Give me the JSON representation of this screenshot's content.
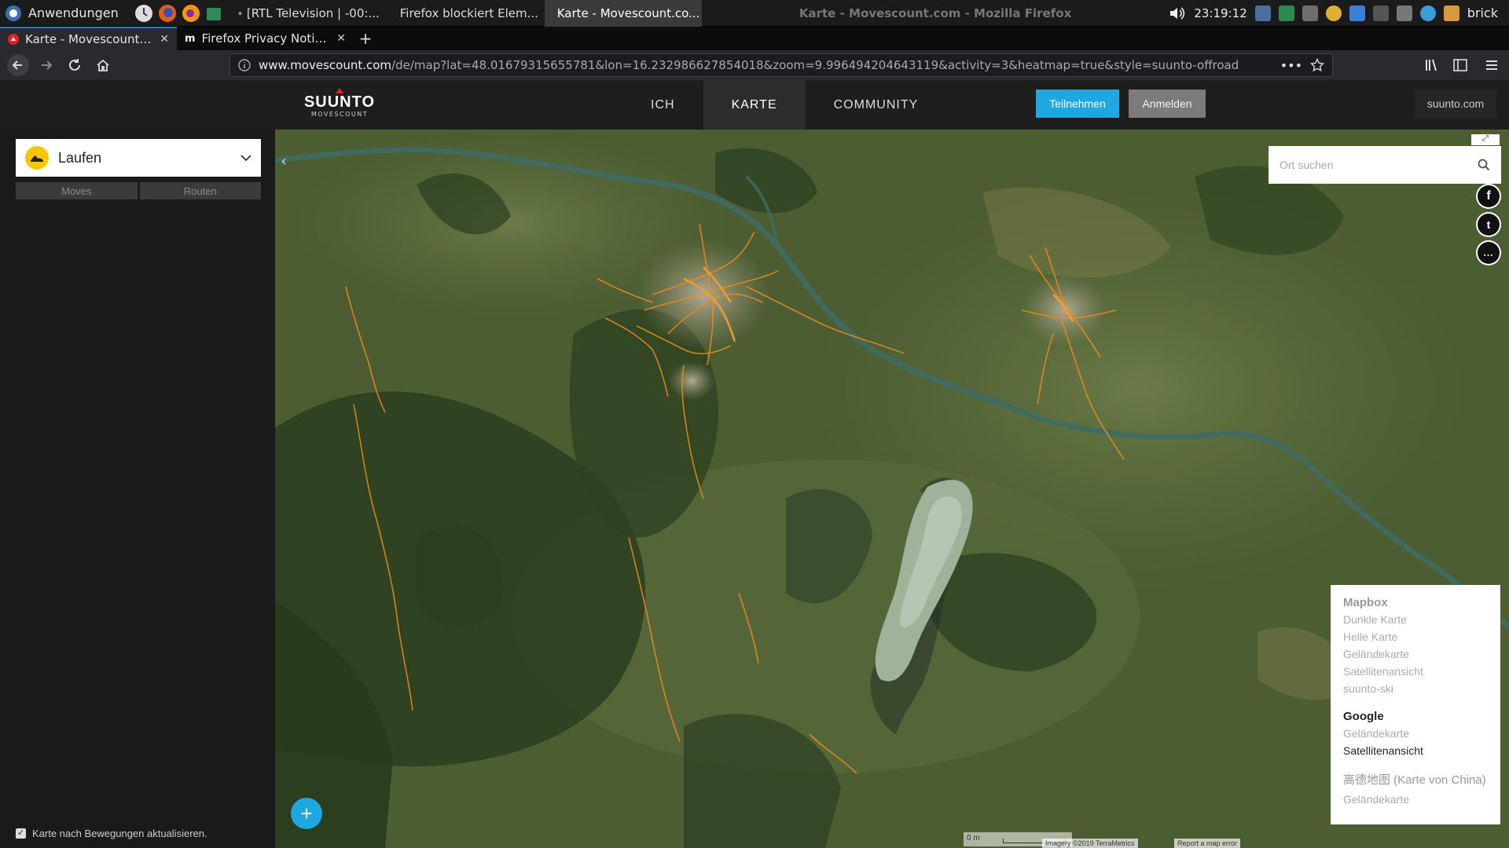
{
  "taskbar": {
    "start_label": "Anwendungen",
    "tasks": [
      {
        "label": "[RTL Television  |  -00:..."
      },
      {
        "label": "Firefox blockiert Elem..."
      },
      {
        "label": "Karte - Movescount.co..."
      }
    ],
    "window_title": "Karte - Movescount.com - Mozilla Firefox",
    "clock": "23:19:12",
    "user": "brick"
  },
  "browser": {
    "tabs": [
      {
        "label": "Karte - Movescount.com"
      },
      {
        "label": "Firefox Privacy Notice —"
      }
    ],
    "url_domain": "www.movescount.com",
    "url_path": "/de/map?lat=48.01679315655781&lon=16.232986627854018&zoom=9.996494204643119&activity=3&heatmap=true&style=suunto-offroad"
  },
  "site": {
    "logo_brand": "SUUNTO",
    "logo_sub": "MOVESCOUNT",
    "nav": [
      {
        "label": "ICH"
      },
      {
        "label": "KARTE"
      },
      {
        "label": "COMMUNITY"
      }
    ],
    "join_label": "Teilnehmen",
    "login_label": "Anmelden",
    "suunto_link": "suunto.com"
  },
  "sidebar": {
    "activity": "Laufen",
    "segments": [
      {
        "label": "Moves"
      },
      {
        "label": "Routen"
      }
    ],
    "auto_update_label": "Karte nach Bewegungen aktualisieren."
  },
  "map": {
    "search_placeholder": "Ort suchen",
    "social": [
      {
        "label": "f"
      },
      {
        "label": "t"
      },
      {
        "label": "..."
      }
    ],
    "layers": {
      "mapbox_title": "Mapbox",
      "mapbox_options": [
        {
          "label": "Dunkle Karte"
        },
        {
          "label": "Helle Karte"
        },
        {
          "label": "Geländekarte"
        },
        {
          "label": "Satellitenansicht"
        },
        {
          "label": "suunto-ski"
        }
      ],
      "google_title": "Google",
      "google_options": [
        {
          "label": "Geländekarte"
        },
        {
          "label": "Satellitenansicht"
        }
      ],
      "china_title": "高德地图 (Karte von China)",
      "china_option": "Geländekarte"
    },
    "scale_label": "0 m",
    "imagery_credit": "Imagery ©2019 TerraMetrics",
    "report_label": "Report a map error"
  },
  "colors": {
    "accent": "#1ea7e1",
    "heatmap": "#f08c1a"
  }
}
